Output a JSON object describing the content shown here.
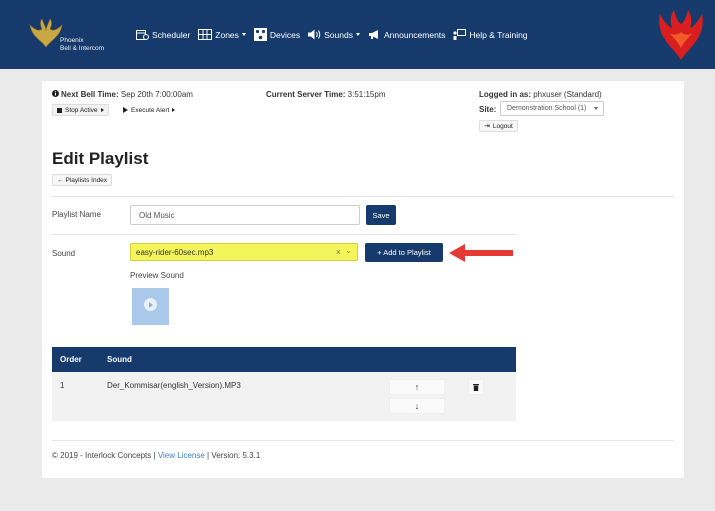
{
  "brand": {
    "line1": "Phoenix",
    "line2": "Bell & Intercom"
  },
  "nav": [
    {
      "label": "Scheduler",
      "dropdown": false
    },
    {
      "label": "Zones",
      "dropdown": true
    },
    {
      "label": "Devices",
      "dropdown": false
    },
    {
      "label": "Sounds",
      "dropdown": true
    },
    {
      "label": "Announcements",
      "dropdown": false
    },
    {
      "label": "Help & Training",
      "dropdown": false
    }
  ],
  "status": {
    "next_bell_label": "Next Bell Time:",
    "next_bell_value": "Sep 20th 7:00:00am",
    "server_time_label": "Current Server Time:",
    "server_time_value": "3:51:15pm",
    "logged_in_label": "Logged in as:",
    "logged_in_value": "phxuser (Standard)",
    "site_label": "Site:",
    "site_value": "Demonstration School (1)",
    "stop_active": "Stop Active",
    "execute_alert": "Execute Alert",
    "logout": "Logout"
  },
  "page": {
    "title": "Edit Playlist",
    "back_button": "Playlists Index",
    "name_label": "Playlist Name",
    "name_value": "Old Music",
    "save_button": "Save",
    "sound_label": "Sound",
    "sound_value": "easy-rider-60sec.mp3",
    "add_button": "+ Add to Playlist",
    "preview_label": "Preview Sound"
  },
  "table": {
    "headers": [
      "Order",
      "Sound"
    ],
    "rows": [
      {
        "order": "1",
        "sound": "Der_Kommisar(english_Version).MP3"
      }
    ]
  },
  "footer": {
    "copyright": "© 2019 - Interlock Concepts |",
    "license_link": "View License",
    "version": "| Version: 5.3.1"
  },
  "colors": {
    "navbar": "#153a6b",
    "primary": "#153a6b",
    "highlight": "#f4f55a",
    "arrow": "#e53935",
    "link": "#3b82c4"
  }
}
